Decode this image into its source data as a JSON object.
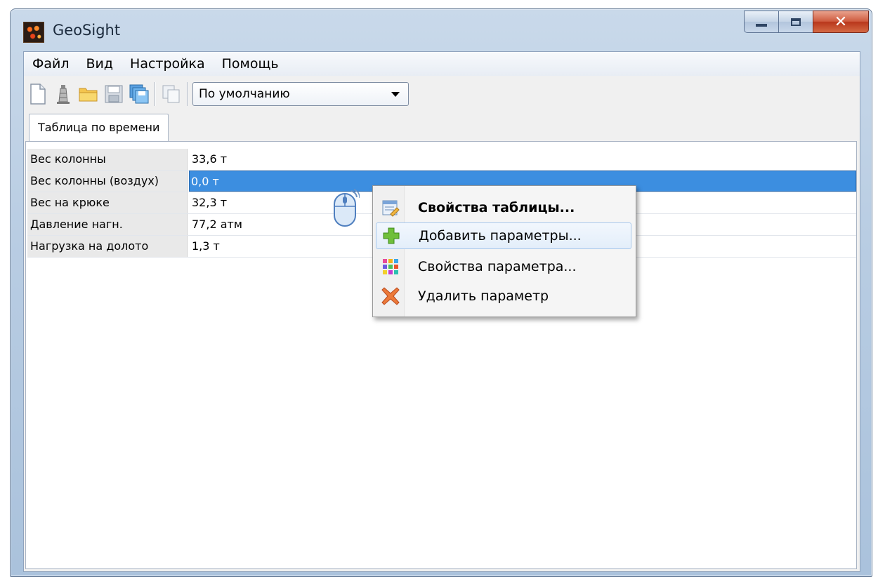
{
  "window": {
    "title": "GeoSight"
  },
  "menu": [
    "Файл",
    "Вид",
    "Настройка",
    "Помощь"
  ],
  "toolbar": {
    "buttons": [
      "new-document-icon",
      "tower-icon",
      "open-folder-icon",
      "save-icon",
      "save-all-icon",
      "copy-icon"
    ],
    "preset_value": "По умолчанию"
  },
  "tab": {
    "label": "Таблица по времени"
  },
  "table": {
    "rows": [
      {
        "name": "Вес колонны",
        "value": "33,6 т"
      },
      {
        "name": "Вес колонны (воздух)",
        "value": "0,0 т"
      },
      {
        "name": "Вес на крюке",
        "value": "32,3 т"
      },
      {
        "name": "Давление нагн.",
        "value": "77,2 атм"
      },
      {
        "name": "Нагрузка на долото",
        "value": "1,3 т"
      }
    ],
    "selected_row": 1
  },
  "context_menu": {
    "items": [
      {
        "label": "Свойства таблицы...",
        "icon": "table-properties-icon",
        "bold": true
      },
      {
        "label": "Добавить параметры...",
        "icon": "add-plus-icon",
        "highlighted": true
      },
      {
        "label": "Свойства параметра...",
        "icon": "color-grid-icon"
      },
      {
        "label": "Удалить параметр",
        "icon": "delete-x-icon"
      }
    ]
  },
  "colors": {
    "selection": "#3c8ee0",
    "close_button": "#cf5b3f"
  }
}
